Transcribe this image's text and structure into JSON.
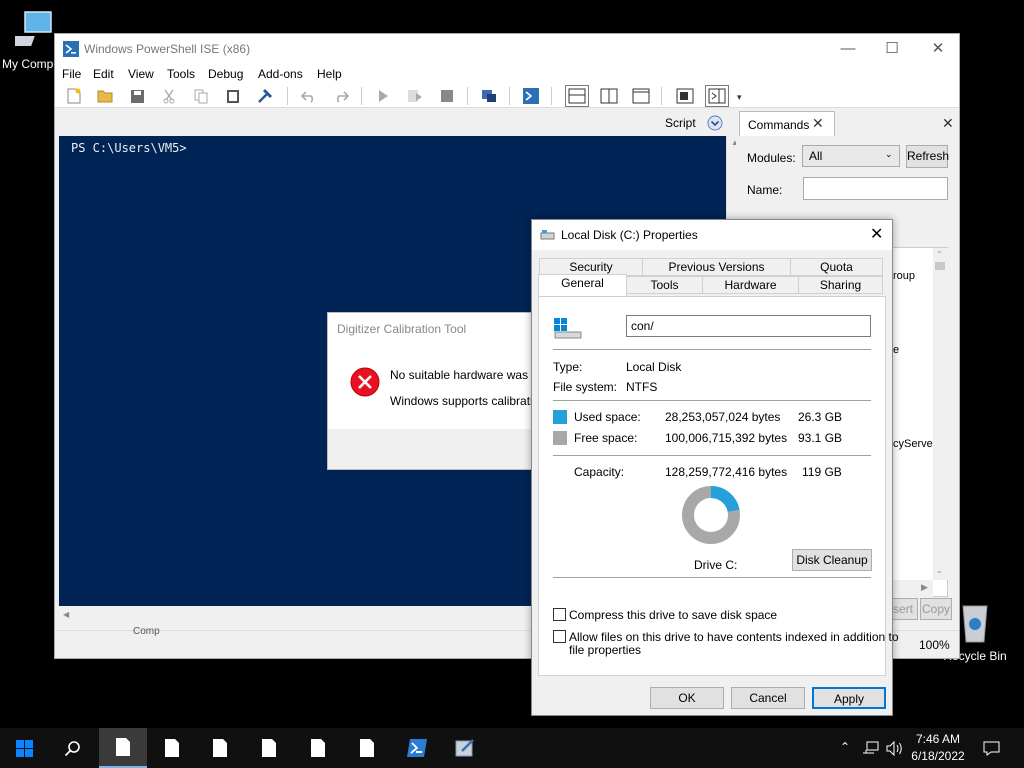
{
  "desktop": {
    "my_computer_label": "My Comp",
    "recycle_bin_label": "Recycle Bin"
  },
  "ise": {
    "title": "Windows PowerShell ISE (x86)",
    "menu": [
      "File",
      "Edit",
      "View",
      "Tools",
      "Debug",
      "Add-ons",
      "Help"
    ],
    "script_label": "Script",
    "prompt": "PS C:\\Users\\VM5>",
    "commands": {
      "tab_label": "Commands",
      "modules_label": "Modules:",
      "modules_value": "All",
      "refresh_label": "Refresh",
      "name_label": "Name:",
      "list_fragments": [
        "roup",
        "e",
        "cyServe"
      ],
      "insert_fragment": "sert",
      "copy_label": "Copy"
    },
    "status_fragment": "Comp",
    "zoom": "100%"
  },
  "calibration": {
    "title": "Digitizer Calibration Tool",
    "line1": "No suitable hardware was f",
    "line2": "Windows supports calibrati"
  },
  "props": {
    "title": "Local Disk (C:) Properties",
    "tabs_row1": [
      "Security",
      "Previous Versions",
      "Quota"
    ],
    "tabs_row2": [
      "General",
      "Tools",
      "Hardware",
      "Sharing"
    ],
    "name_value": "con/",
    "type_label": "Type:",
    "type_value": "Local Disk",
    "fs_label": "File system:",
    "fs_value": "NTFS",
    "used_label": "Used space:",
    "used_bytes": "28,253,057,024 bytes",
    "used_gb": "26.3 GB",
    "free_label": "Free space:",
    "free_bytes": "100,006,715,392 bytes",
    "free_gb": "93.1 GB",
    "cap_label": "Capacity:",
    "cap_bytes": "128,259,772,416 bytes",
    "cap_gb": "119 GB",
    "drive_label": "Drive C:",
    "cleanup_label": "Disk Cleanup",
    "compress_label": "Compress this drive to save disk space",
    "index_label_1": "Allow files on this drive to have contents indexed in addition to",
    "index_label_2": "file properties",
    "ok_label": "OK",
    "cancel_label": "Cancel",
    "apply_label": "Apply",
    "used_fraction": 0.22,
    "colors": {
      "used": "#26a0da",
      "free": "#a8a8a8"
    }
  },
  "taskbar": {
    "time": "7:46 AM",
    "date": "6/18/2022"
  }
}
